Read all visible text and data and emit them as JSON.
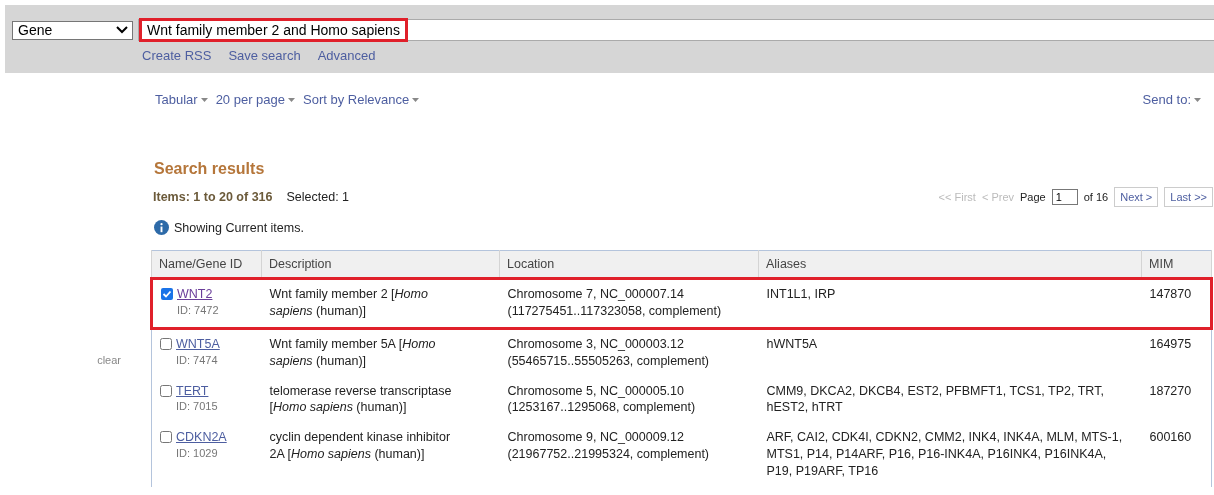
{
  "search_bar": {
    "database": "Gene",
    "query": "Wnt family member 2 and Homo sapiens",
    "query_highlighted": true,
    "links": [
      "Create RSS",
      "Save search",
      "Advanced"
    ]
  },
  "display_options": [
    "Tabular",
    "20 per page",
    "Sort by Relevance"
  ],
  "send_to": "Send to:",
  "results": {
    "title": "Search results",
    "items_count": "Items: 1 to 20 of 316",
    "selected_count": "Selected: 1",
    "pager": {
      "first": "<< First",
      "prev": "< Prev",
      "page_label": "Page",
      "page": "1",
      "of": "of 16",
      "next": "Next >",
      "last": "Last >>"
    },
    "notice": "Showing Current items."
  },
  "sidebar": {
    "clear": "clear"
  },
  "table": {
    "columns": [
      "Name/Gene ID",
      "Description",
      "Location",
      "Aliases",
      "MIM"
    ],
    "rows": [
      {
        "checked": true,
        "highlighted": true,
        "name": "WNT2",
        "id": "ID: 7472",
        "description": "Wnt family member 2 [*Homo sapiens* (human)]",
        "location": [
          "Chromosome 7, NC_000007.14",
          "(117275451..117323058, complement)"
        ],
        "aliases": "INT1L1, IRP",
        "mim": "147870"
      },
      {
        "checked": false,
        "highlighted": false,
        "name": "WNT5A",
        "id": "ID: 7474",
        "description": "Wnt family member 5A [*Homo sapiens* (human)]",
        "location": [
          "Chromosome 3, NC_000003.12",
          "(55465715..55505263, complement)"
        ],
        "aliases": "hWNT5A",
        "mim": "164975"
      },
      {
        "checked": false,
        "highlighted": false,
        "name": "TERT",
        "id": "ID: 7015",
        "description": "telomerase reverse transcriptase [*Homo sapiens* (human)]",
        "location": [
          "Chromosome 5, NC_000005.10",
          "(1253167..1295068, complement)"
        ],
        "aliases": "CMM9, DKCA2, DKCB4, EST2, PFBMFT1, TCS1, TP2, TRT, hEST2, hTRT",
        "mim": "187270"
      },
      {
        "checked": false,
        "highlighted": false,
        "name": "CDKN2A",
        "id": "ID: 1029",
        "description": "cyclin dependent kinase inhibitor 2A [*Homo sapiens* (human)]",
        "location": [
          "Chromosome 9, NC_000009.12",
          "(21967752..21995324, complement)"
        ],
        "aliases": "ARF, CAI2, CDK4I, CDKN2, CMM2, INK4, INK4A, MLM, MTS-1, MTS1, P14, P14ARF, P16, P16-INK4A, P16INK4, P16INK4A, P19, P19ARF, TP16",
        "mim": "600160"
      }
    ]
  }
}
